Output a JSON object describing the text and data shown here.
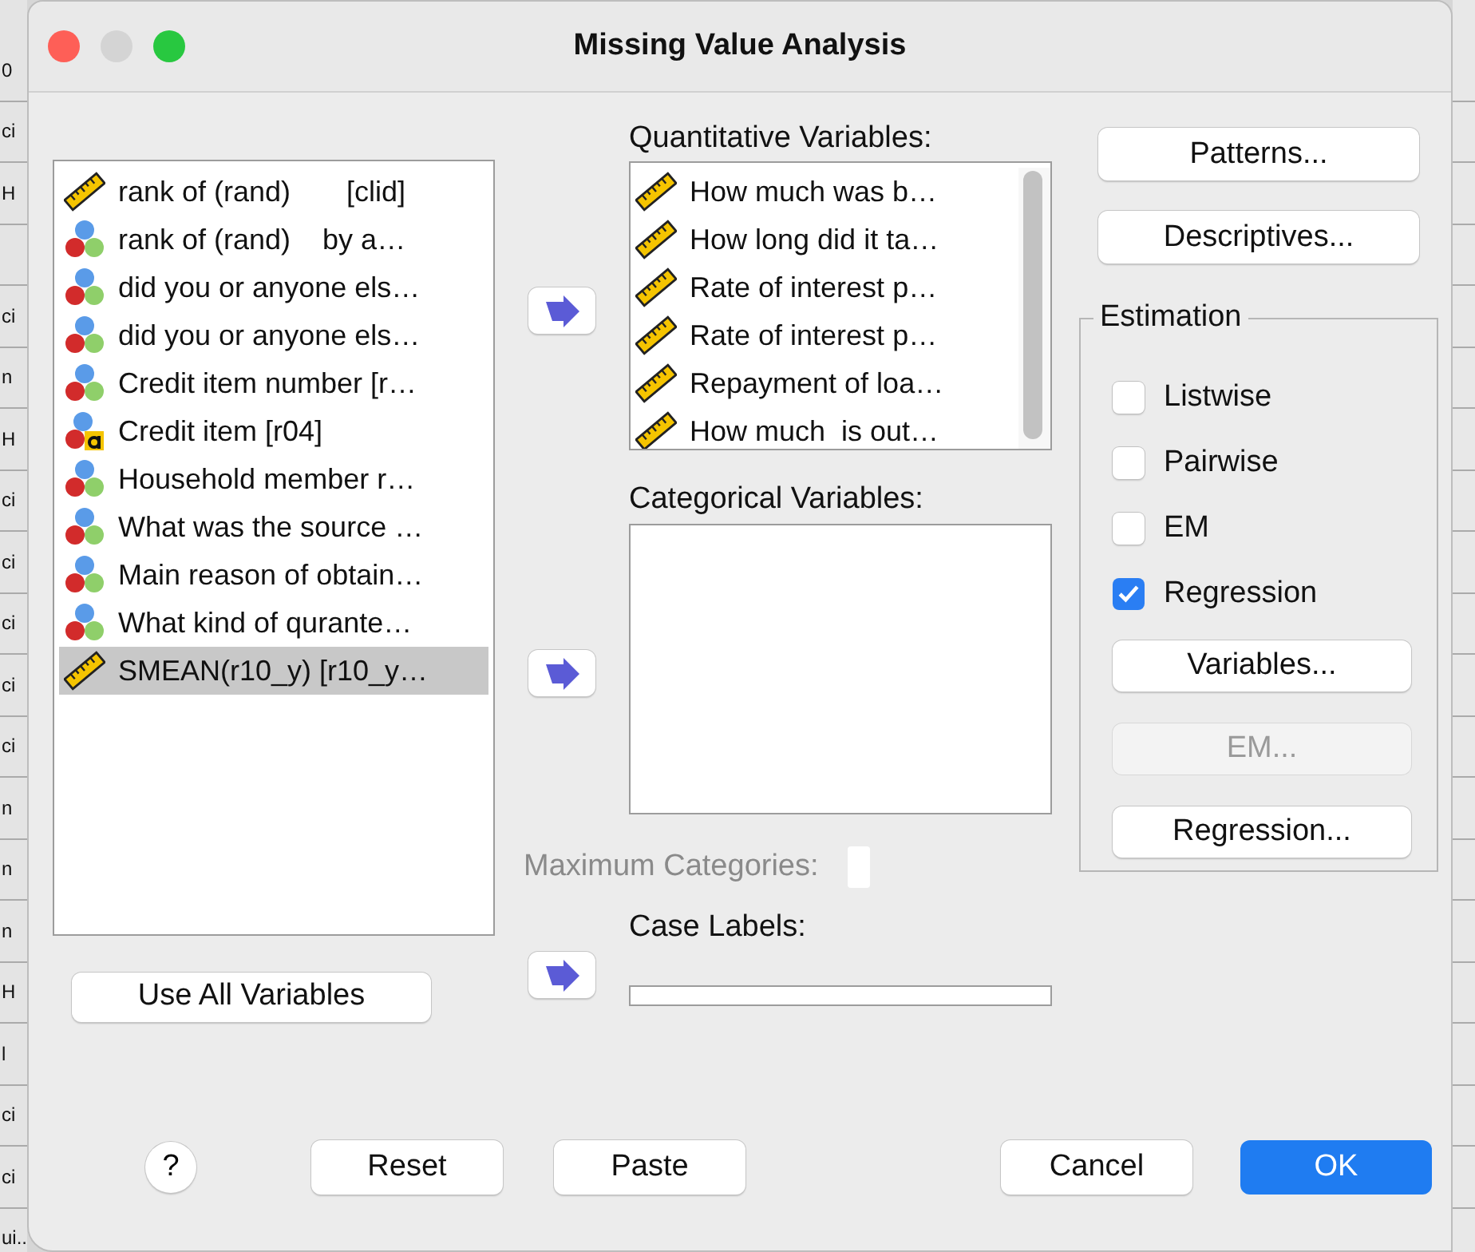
{
  "background_sheet": {
    "cells": [
      {
        "text": "0"
      },
      {
        "text": "ci"
      },
      {
        "text": "H"
      },
      {},
      {
        "text": "ci"
      },
      {
        "text": "n"
      },
      {
        "text": "H"
      },
      {
        "text": "ci"
      },
      {
        "text": "ci"
      },
      {
        "text": "ci"
      },
      {
        "text": "ci"
      },
      {
        "text": "ci"
      },
      {
        "text": "n"
      },
      {
        "text": "n"
      },
      {
        "text": "n"
      },
      {
        "text": "H"
      },
      {
        "text": "l"
      },
      {
        "text": "ci"
      },
      {
        "text": "ci"
      },
      {
        "text": "ui.."
      }
    ]
  },
  "window": {
    "title": "Missing Value Analysis"
  },
  "source_list": {
    "items": [
      {
        "label": "rank of (rand)       [clid]",
        "kind": "scale",
        "selected": false
      },
      {
        "label": "rank of (rand)    by a…",
        "kind": "nominal",
        "selected": false
      },
      {
        "label": "did you or anyone els…",
        "kind": "nominal",
        "selected": false
      },
      {
        "label": "did you or anyone els…",
        "kind": "nominal",
        "selected": false
      },
      {
        "label": "Credit item number [r…",
        "kind": "nominal",
        "selected": false
      },
      {
        "label": "Credit item [r04]",
        "kind": "string",
        "selected": false
      },
      {
        "label": "Household member r…",
        "kind": "nominal",
        "selected": false
      },
      {
        "label": "What was the source …",
        "kind": "nominal",
        "selected": false
      },
      {
        "label": "Main reason of obtain…",
        "kind": "nominal",
        "selected": false
      },
      {
        "label": "What kind of qurante…",
        "kind": "nominal",
        "selected": false
      },
      {
        "label": "SMEAN(r10_y) [r10_y…",
        "kind": "scale",
        "selected": true
      }
    ]
  },
  "quantitative": {
    "label": "Quantitative Variables:",
    "items": [
      {
        "label": "How much was b…",
        "kind": "scale"
      },
      {
        "label": "How long did it ta…",
        "kind": "scale"
      },
      {
        "label": "Rate of interest p…",
        "kind": "scale"
      },
      {
        "label": "Rate of interest p…",
        "kind": "scale"
      },
      {
        "label": "Repayment of loa…",
        "kind": "scale"
      },
      {
        "label": "How much  is out…",
        "kind": "scale"
      }
    ]
  },
  "categorical": {
    "label": "Categorical Variables:"
  },
  "maximum_categories": {
    "label": "Maximum Categories:",
    "disabled": true
  },
  "case_labels": {
    "label": "Case Labels:"
  },
  "side_buttons": [
    "Patterns...",
    "Descriptives..."
  ],
  "estimation": {
    "title": "Estimation",
    "options": [
      {
        "label": "Listwise",
        "checked": false
      },
      {
        "label": "Pairwise",
        "checked": false
      },
      {
        "label": "EM",
        "checked": false
      },
      {
        "label": "Regression",
        "checked": true
      }
    ],
    "buttons": [
      {
        "label": "Variables...",
        "disabled": false
      },
      {
        "label": "EM...",
        "disabled": true
      },
      {
        "label": "Regression...",
        "disabled": false
      }
    ]
  },
  "use_all_button": "Use All Variables",
  "footer": {
    "help": "?",
    "buttons": [
      {
        "label": "Reset",
        "kind": "normal"
      },
      {
        "label": "Paste",
        "kind": "normal"
      },
      {
        "label": "Cancel",
        "kind": "normal"
      },
      {
        "label": "OK",
        "kind": "default"
      }
    ]
  }
}
